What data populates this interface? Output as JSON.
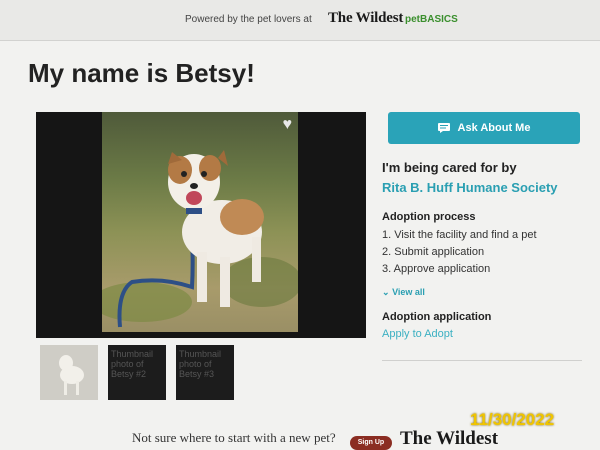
{
  "header": {
    "powered_by": "Powered by the pet lovers at",
    "brand_wildest": "The Wildest",
    "brand_petbasics": "petBASICS"
  },
  "pet": {
    "title": "My name is Betsy!"
  },
  "gallery": {
    "thumb2_text": "Thumbnail photo of Betsy #2",
    "thumb3_text": "Thumbnail photo of Betsy #3"
  },
  "sidebar": {
    "ask_label": "Ask About Me",
    "cared_by": "I'm being cared for by",
    "organization": "Rita B. Huff Humane Society",
    "adoption_process_heading": "Adoption process",
    "steps": [
      "1. Visit the facility and find a pet",
      "2. Submit application",
      "3. Approve application"
    ],
    "view_all": "View all",
    "adoption_application_heading": "Adoption application",
    "apply_link": "Apply to Adopt"
  },
  "footer": {
    "text": "Not sure where to start with a new pet?",
    "signup": "Sign Up",
    "brand": "The Wildest"
  },
  "overlay": {
    "date_stamp": "11/30/2022"
  },
  "colors": {
    "accent": "#2aa3b8",
    "signup": "#8b2d22"
  }
}
